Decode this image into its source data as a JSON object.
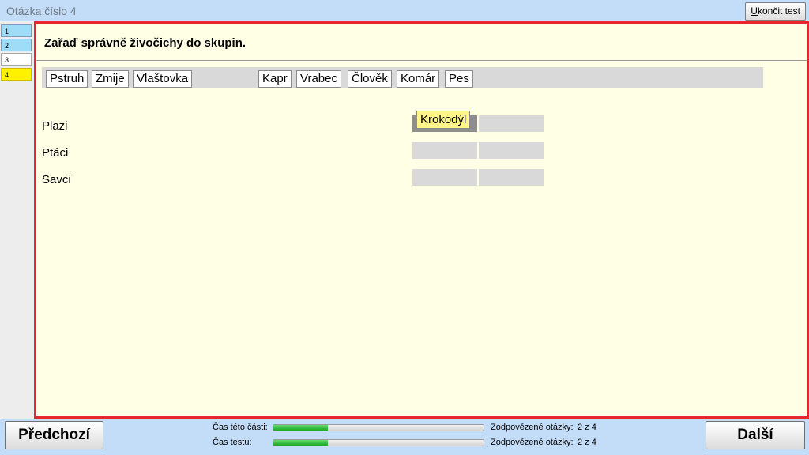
{
  "window": {
    "title": "Otázka číslo 4",
    "end_test_label": "Ukončit test"
  },
  "question_nav": [
    {
      "label": "1",
      "state": "answered"
    },
    {
      "label": "2",
      "state": "answered"
    },
    {
      "label": "3",
      "state": "unanswered"
    },
    {
      "label": "4",
      "state": "current"
    }
  ],
  "question": {
    "text": "Zařaď správně živočichy do skupin.",
    "bank_items": [
      "Pstruh",
      "Zmije",
      "Vlaštovka",
      "Kapr",
      "Vrabec",
      "Člověk",
      "Komár",
      "Pes"
    ],
    "categories": [
      {
        "label": "Plazi",
        "placed": [
          "Krokodýl"
        ]
      },
      {
        "label": "Ptáci",
        "placed": []
      },
      {
        "label": "Savci",
        "placed": []
      }
    ]
  },
  "footer": {
    "prev_label": "Předchozí",
    "next_label": "Další",
    "section_time_label": "Čas této části:",
    "test_time_label": "Čas testu:",
    "section_time_progress": 0.26,
    "test_time_progress": 0.26,
    "answered_label_1": "Zodpovězené otázky:",
    "answered_value_1": "2 z 4",
    "answered_label_2": "Zodpovězené otázky:",
    "answered_value_2": "2 z 4"
  },
  "colors": {
    "accent_border": "#e8262e",
    "answered": "#9fdcf7",
    "current": "#fff200",
    "placed_tile": "#fff58a"
  }
}
